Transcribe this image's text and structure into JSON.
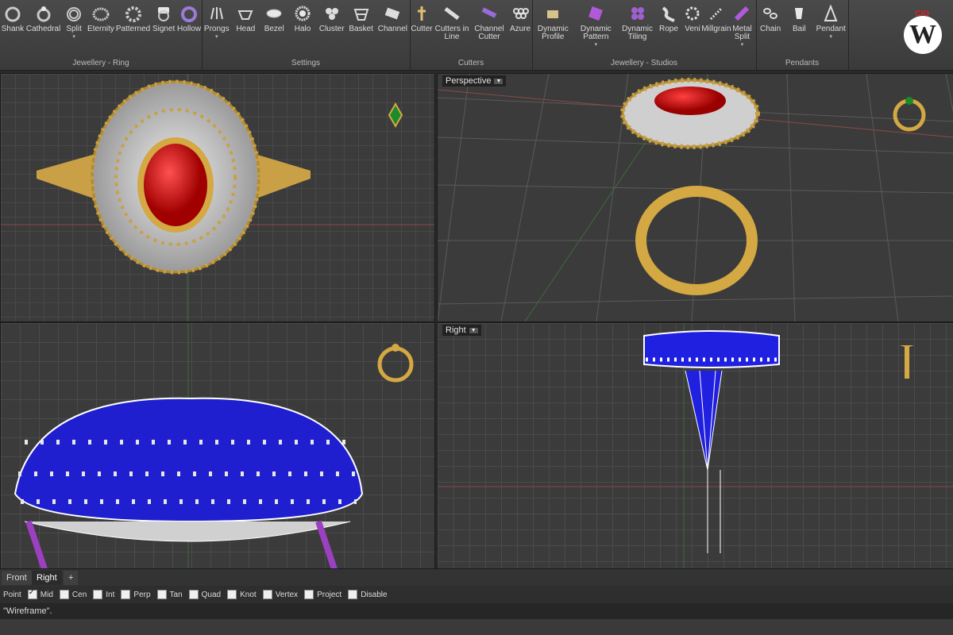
{
  "ribbon": {
    "groups": [
      {
        "label": "Jewellery - Ring",
        "tools": [
          "Shank",
          "Cathedral",
          "Split",
          "Eternity",
          "Patterned",
          "Signet",
          "Hollow"
        ]
      },
      {
        "label": "Settings",
        "tools": [
          "Prongs",
          "Head",
          "Bezel",
          "Halo",
          "Cluster",
          "Basket",
          "Channel"
        ]
      },
      {
        "label": "Cutters",
        "tools": [
          "Cutter",
          "Cutters in Line",
          "Channel Cutter",
          "Azure"
        ]
      },
      {
        "label": "Jewellery - Studios",
        "tools": [
          "Dynamic Profile",
          "Dynamic Pattern",
          "Dynamic Tiling",
          "Rope",
          "Veni",
          "Millgrain",
          "Metal Split"
        ]
      },
      {
        "label": "Pendants",
        "tools": [
          "Chain",
          "Bail",
          "Pendant"
        ]
      }
    ],
    "logo": {
      "text": "W",
      "badge": "CIO"
    }
  },
  "viewports": {
    "top": {
      "label": ""
    },
    "perspective": {
      "label": "Perspective"
    },
    "front": {
      "label": ""
    },
    "right": {
      "label": "Right"
    }
  },
  "bottom_tabs": [
    "Front",
    "Right",
    "+"
  ],
  "osnap": [
    {
      "label": "Point",
      "checked": false
    },
    {
      "label": "Mid",
      "checked": true
    },
    {
      "label": "Cen",
      "checked": false
    },
    {
      "label": "Int",
      "checked": false
    },
    {
      "label": "Perp",
      "checked": false
    },
    {
      "label": "Tan",
      "checked": false
    },
    {
      "label": "Quad",
      "checked": false
    },
    {
      "label": "Knot",
      "checked": false
    },
    {
      "label": "Vertex",
      "checked": false
    },
    {
      "label": "Project",
      "checked": false
    },
    {
      "label": "Disable",
      "checked": false
    }
  ],
  "command_line": "\"Wireframe\".",
  "colors": {
    "gold": "#d4a843",
    "ruby": "#cc1a1a",
    "sapphire": "#1f1fd0",
    "emerald": "#1a8a2a",
    "grid": "#595959"
  }
}
